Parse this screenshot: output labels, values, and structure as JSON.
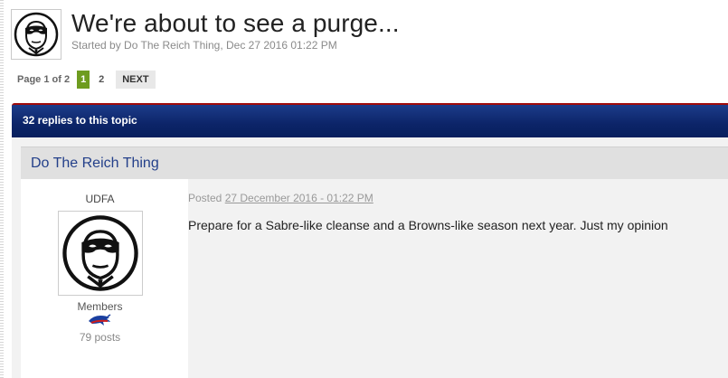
{
  "topic": {
    "title": "We're about to see a purge...",
    "meta": "Started by Do The Reich Thing, Dec 27 2016 01:22 PM",
    "avatar_icon": "masked-man-avatar-icon"
  },
  "pagination": {
    "page_of": "Page 1 of 2",
    "pages": [
      "1",
      "2"
    ],
    "current_page": "1",
    "next_label": "NEXT"
  },
  "replies": {
    "count_label": "32 replies to this topic"
  },
  "post": {
    "author_name": "Do The Reich Thing",
    "author_title": "UDFA",
    "author_group": "Members",
    "author_posts": "79 posts",
    "group_icon": "bills-buffalo-icon",
    "posted_label": "Posted",
    "posted_date": "27 December 2016 - 01:22 PM",
    "body": "Prepare for a Sabre-like cleanse and a Browns-like season next year. Just my opinion"
  },
  "colors": {
    "header_bar": "#0c2468",
    "header_accent": "#a00b0b",
    "active_page": "#6e9c1f",
    "author_link": "#24408a"
  }
}
